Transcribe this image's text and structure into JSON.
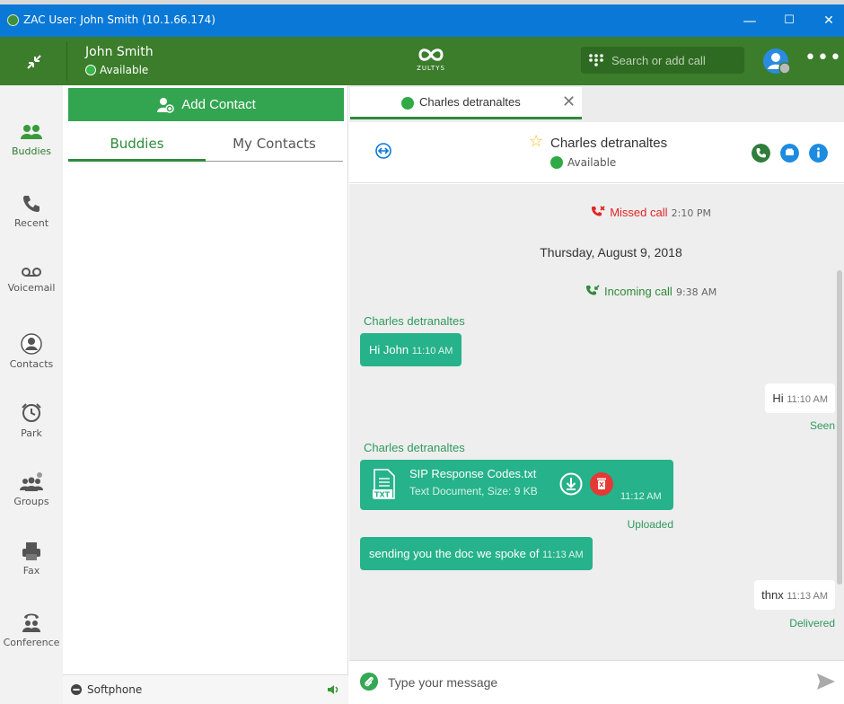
{
  "window": {
    "title": "ZAC User: John Smith (10.1.66.174)",
    "controls": [
      "—",
      "☐",
      "✕"
    ]
  },
  "header": {
    "user_name": "John Smith",
    "user_status": "Available",
    "logo_text": "ZULTYS",
    "search_placeholder": "Search or add call",
    "more_label": "•••"
  },
  "rail": {
    "items": [
      {
        "label": "Buddies",
        "icon": "buddies-icon",
        "active": true
      },
      {
        "label": "Recent",
        "icon": "phone-icon"
      },
      {
        "label": "Voicemail",
        "icon": "voicemail-icon"
      },
      {
        "label": "Contacts",
        "icon": "contacts-icon"
      },
      {
        "label": "Park",
        "icon": "park-icon"
      },
      {
        "label": "Groups",
        "icon": "groups-icon"
      },
      {
        "label": "Fax",
        "icon": "fax-icon"
      },
      {
        "label": "Conference",
        "icon": "conference-icon"
      }
    ]
  },
  "contacts_panel": {
    "add_contact_label": "Add Contact",
    "tabs": [
      "Buddies",
      "My Contacts"
    ],
    "softphone_label": "Softphone"
  },
  "chat": {
    "tab_name": "Charles detranaltes",
    "tab_close": "✕",
    "contact_name": "Charles detranaltes",
    "contact_status": "Available",
    "messages": {
      "missed_call": "Missed call",
      "missed_time": "2:10 PM",
      "date_separator": "Thursday, August 9, 2018",
      "incoming_call": "Incoming call",
      "incoming_time": "9:38 AM",
      "sender_1": "Charles detranaltes",
      "msg_1": "Hi John",
      "msg_1_time": "11:10 AM",
      "out_1": "Hi",
      "out_1_time": "11:10 AM",
      "out_1_receipt": "Seen",
      "sender_2": "Charles detranaltes",
      "file_name": "SIP Response Codes.txt",
      "file_meta": "Text Document, Size: 9 KB",
      "file_time": "11:12 AM",
      "file_receipt": "Uploaded",
      "msg_2": "sending you the doc we spoke of",
      "msg_2_time": "11:13 AM",
      "out_2": "thnx",
      "out_2_time": "11:13 AM",
      "out_2_receipt": "Delivered"
    },
    "composer_placeholder": "Type your message"
  },
  "colors": {
    "titlebar": "#0a78d6",
    "header": "#3b7d2b",
    "accent_green": "#33a551",
    "bubble_teal": "#26b28a",
    "missed_red": "#e02424"
  }
}
